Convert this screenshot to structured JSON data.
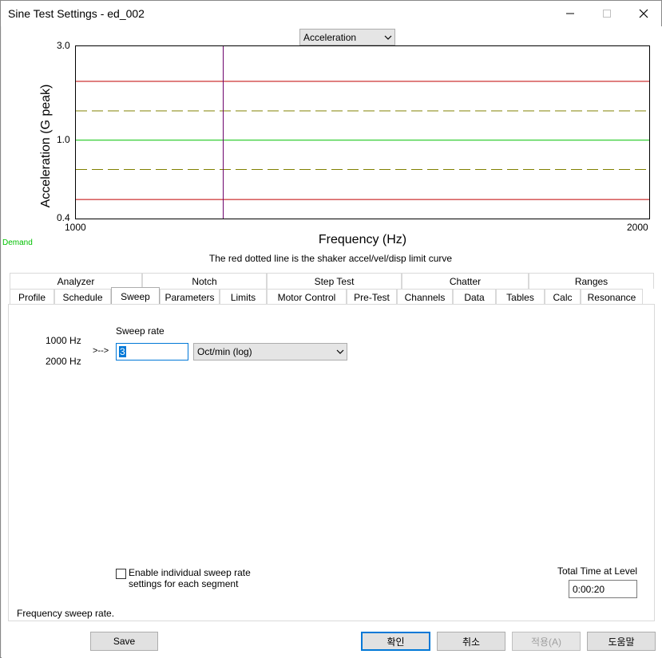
{
  "window": {
    "title": "Sine Test Settings - ed_002",
    "minimize_icon": "minimize-icon",
    "maximize_icon": "maximize-icon",
    "close_icon": "close-icon"
  },
  "plot_selector": {
    "value": "Acceleration"
  },
  "chart_data": {
    "type": "line",
    "xlabel": "Frequency (Hz)",
    "ylabel": "Acceleration (G peak)",
    "x_ticks": [
      "1000",
      "2000"
    ],
    "y_ticks": [
      "3.0",
      "1.0",
      "0.4"
    ],
    "xlim": [
      1000,
      2000
    ],
    "ylim": [
      0.4,
      3.0
    ],
    "y_scale": "log",
    "series": [
      {
        "name": "Demand",
        "color": "#00c000",
        "style": "solid",
        "x": [
          1000,
          2000
        ],
        "y": [
          1.0,
          1.0
        ]
      }
    ],
    "reference_lines": [
      {
        "color": "#c00000",
        "style": "solid",
        "y": 1.99
      },
      {
        "color": "#808000",
        "style": "dashed",
        "y": 1.41
      },
      {
        "color": "#808000",
        "style": "dashed",
        "y": 0.71
      },
      {
        "color": "#c00000",
        "style": "solid",
        "y": 0.5
      }
    ],
    "cursor": {
      "color": "#6a006a",
      "x": 1257
    }
  },
  "demand_label": "Demand",
  "caption": "The red dotted line is the shaker accel/vel/disp limit curve",
  "tabs_row1": [
    "Analyzer",
    "Notch",
    "Step Test",
    "Chatter",
    "Ranges"
  ],
  "tabs_row2": [
    "Profile",
    "Schedule",
    "Sweep",
    "Parameters",
    "Limits",
    "Motor Control",
    "Pre-Test",
    "Channels",
    "Data",
    "Tables",
    "Calc",
    "Resonance"
  ],
  "active_tab": "Sweep",
  "sweep": {
    "start_freq": "1000 Hz",
    "end_freq": "2000 Hz",
    "arrow": ">-->",
    "rate_label": "Sweep rate",
    "rate_value": "3",
    "rate_unit": "Oct/min (log)",
    "enable_individual": "Enable individual sweep rate settings for each segment",
    "total_time_label": "Total Time at Level",
    "total_time_value": "0:00:20",
    "help_text": "Frequency sweep rate."
  },
  "buttons": {
    "save": "Save",
    "ok": "확인",
    "cancel": "취소",
    "apply": "적용(A)",
    "help": "도움말"
  }
}
